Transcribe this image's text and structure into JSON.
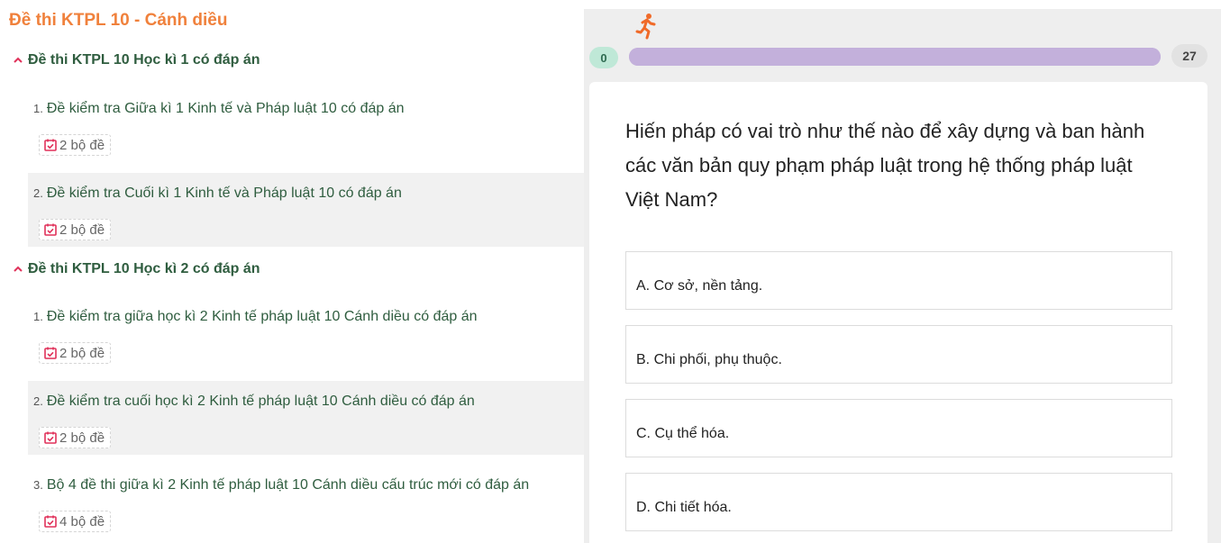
{
  "left": {
    "title": "Đề thi KTPL 10 - Cánh diều",
    "sections": [
      {
        "heading": "Đề thi KTPL 10 Học kì 1 có đáp án",
        "items": [
          {
            "num": "1.",
            "title": "Đề kiểm tra Giữa kì 1 Kinh tế và Pháp luật 10 có đáp án",
            "badge": "2 bộ đề"
          },
          {
            "num": "2.",
            "title": "Đề kiểm tra Cuối kì 1 Kinh tế và Pháp luật 10 có đáp án",
            "badge": "2 bộ đề"
          }
        ]
      },
      {
        "heading": "Đề thi KTPL 10 Học kì 2 có đáp án",
        "items": [
          {
            "num": "1.",
            "title": "Đề kiểm tra giữa học kì 2 Kinh tế pháp luật 10 Cánh diều có đáp án",
            "badge": "2 bộ đề"
          },
          {
            "num": "2.",
            "title": "Đề kiểm tra cuối học kì 2 Kinh tế pháp luật 10 Cánh diều có đáp án",
            "badge": "2 bộ đề"
          },
          {
            "num": "3.",
            "title": "Bộ 4 đề thi giữa kì 2 Kinh tế pháp luật 10 Cánh diều cấu trúc mới có đáp án",
            "badge": "4 bộ đề"
          }
        ]
      }
    ]
  },
  "quiz": {
    "start_value": "0",
    "end_value": "27",
    "progress_fraction": 1.0,
    "question": "Hiến pháp có vai trò như thế nào để xây dựng và ban hành các văn bản quy phạm pháp luật trong hệ thống pháp luật Việt Nam?",
    "options": [
      "A. Cơ sở, nền tảng.",
      "B. Chi phối, phụ thuộc.",
      "C. Cụ thể hóa.",
      "D. Chi tiết hóa."
    ]
  },
  "colors": {
    "title_orange": "#f0813c",
    "heading_green": "#2f5d3f",
    "badge_icon_red": "#e0315a",
    "progress_purple": "#c3b0db",
    "start_pill_green": "#bfe8d7",
    "runner_orange": "#f06a28"
  },
  "icons": {
    "section_caret": "caret-up-icon",
    "badge": "calendar-check-icon",
    "runner": "running-person-icon"
  }
}
